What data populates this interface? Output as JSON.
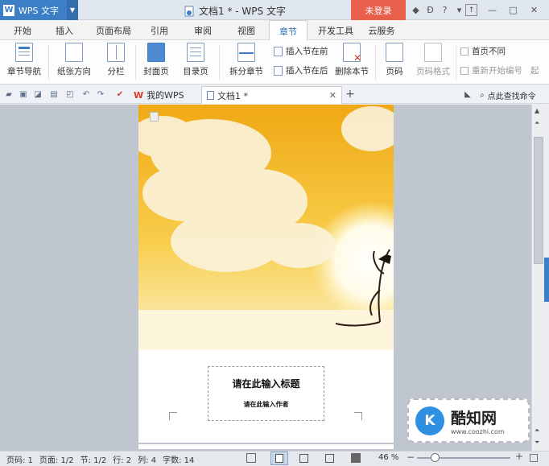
{
  "app": {
    "name": "WPS 文字",
    "logo_text": "W"
  },
  "window": {
    "title": "文档1 * - WPS 文字",
    "login_label": "未登录"
  },
  "menu": {
    "tabs": [
      {
        "label": "开始"
      },
      {
        "label": "插入"
      },
      {
        "label": "页面布局"
      },
      {
        "label": "引用"
      },
      {
        "label": "审阅"
      },
      {
        "label": "视图"
      },
      {
        "label": "章节"
      },
      {
        "label": "开发工具"
      },
      {
        "label": "云服务"
      }
    ],
    "active_tab": "章节"
  },
  "ribbon": {
    "chapter_nav": "章节导航",
    "paper_orientation": "纸张方向",
    "columns": "分栏",
    "cover_page": "封面页",
    "toc_page": "目录页",
    "split_chapter": "拆分章节",
    "insert_section_before": "插入节在前",
    "insert_section_after": "插入节在后",
    "delete_section": "删除本节",
    "page_number": "页码",
    "page_number_format": "页码格式",
    "first_page_different": "首页不同",
    "restart_numbering": "重新开始编号",
    "start_cut": "起"
  },
  "doc_tabs": {
    "my_wps": "我的WPS",
    "doc1": "文档1 *",
    "search_cmd": "点此查找命令"
  },
  "document": {
    "title_placeholder": "请在此输入标题",
    "author_placeholder": "请在此输入作者"
  },
  "status": {
    "page_code": "页码: 1",
    "page": "页面: 1/2",
    "section": "节: 1/2",
    "row": "行: 2",
    "column": "列: 4",
    "word_count": "字数: 14",
    "zoom": "46 %",
    "zoom_level": 0.46
  },
  "watermark": {
    "logo_text": "K",
    "brand": "酷知网",
    "url": "www.coozhi.com"
  },
  "colors": {
    "accent": "#3c7fc6",
    "login": "#e8604c",
    "sky_top": "#f2b21a",
    "sky_bottom": "#fbe9a8"
  }
}
